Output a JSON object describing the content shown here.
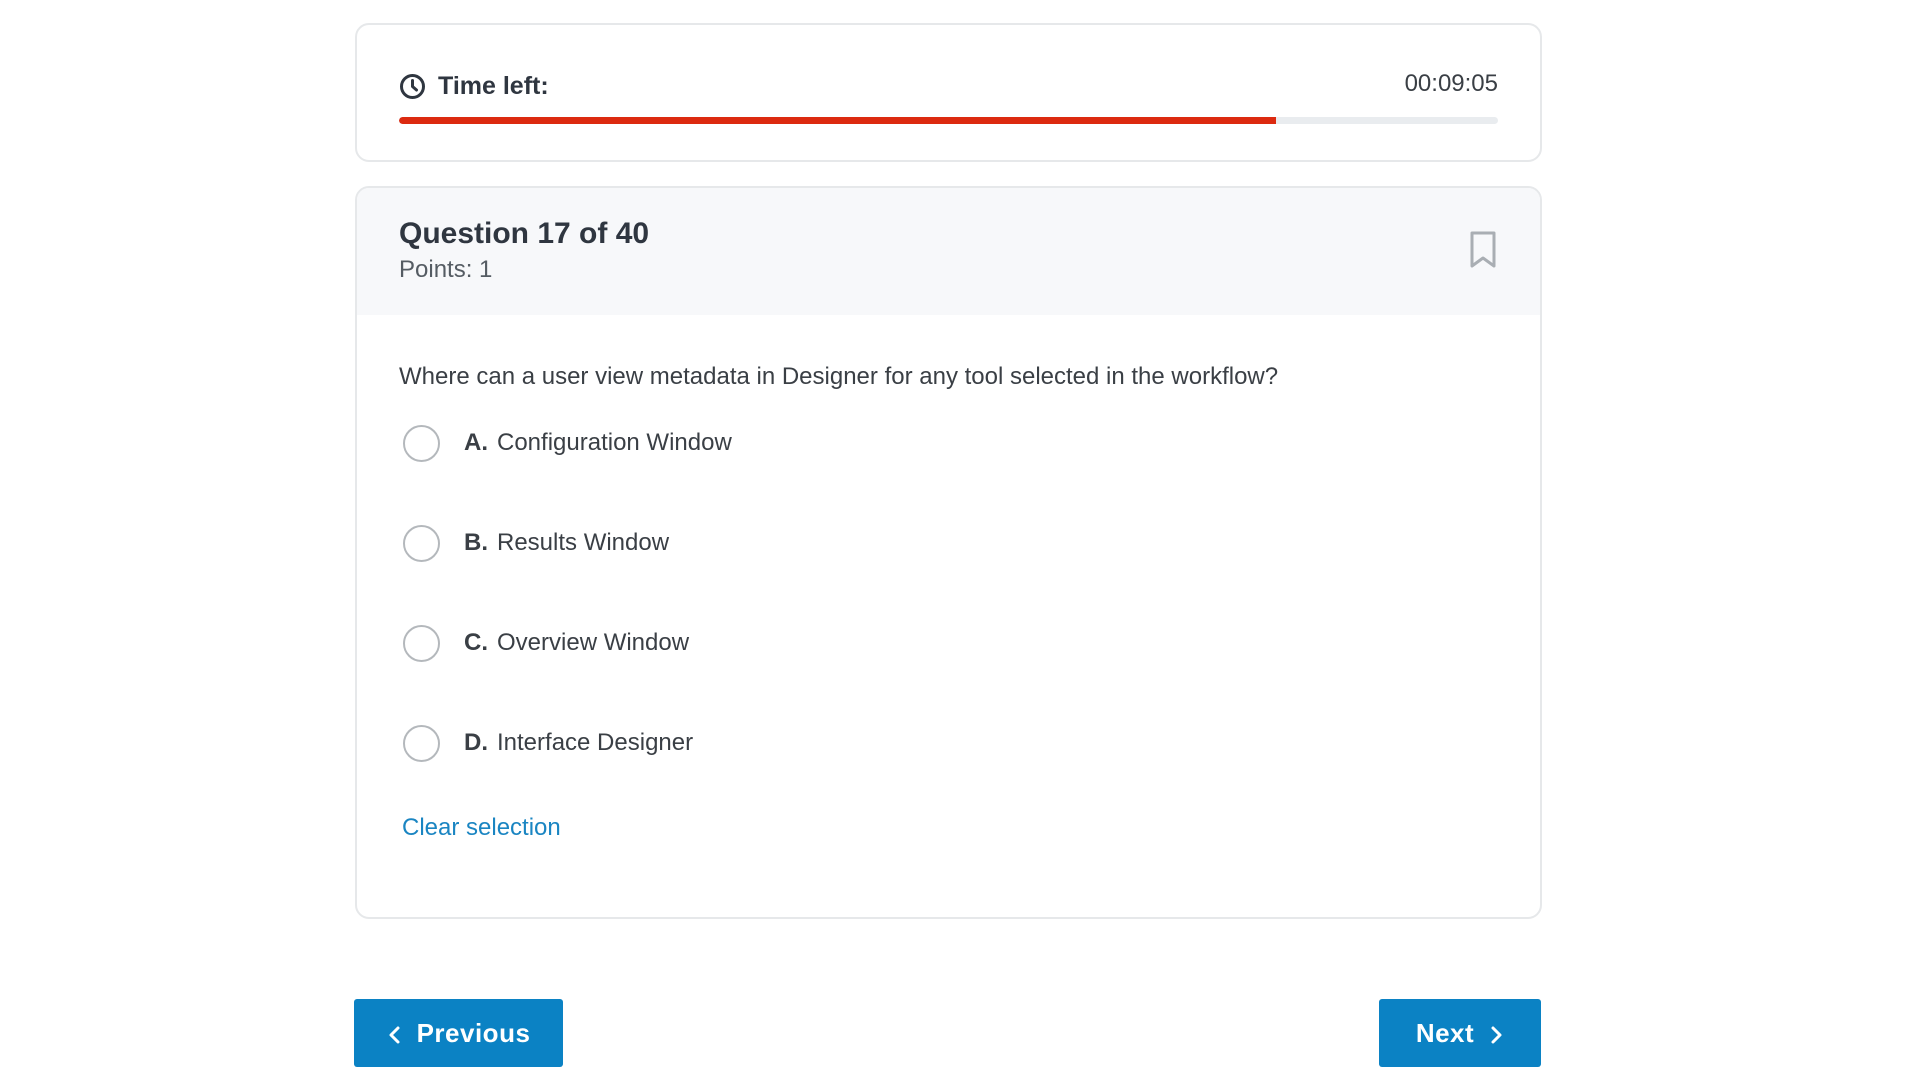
{
  "timer": {
    "label": "Time left:",
    "value": "00:09:05",
    "progress_fraction": 0.798,
    "progress_color": "#dc2a10",
    "icon": "clock-icon"
  },
  "question": {
    "title": "Question 17 of 40",
    "points": "Points: 1",
    "text": "Where can a user view metadata in Designer for any tool selected in the workflow?",
    "bookmark_icon": "bookmark-icon",
    "options": [
      {
        "letter": "A.",
        "text": "Configuration Window"
      },
      {
        "letter": "B.",
        "text": "Results Window"
      },
      {
        "letter": "C.",
        "text": "Overview Window"
      },
      {
        "letter": "D.",
        "text": "Interface Designer"
      }
    ],
    "clear_label": "Clear selection"
  },
  "nav": {
    "previous_label": "Previous",
    "next_label": "Next",
    "accent_color": "#0b82c4"
  }
}
